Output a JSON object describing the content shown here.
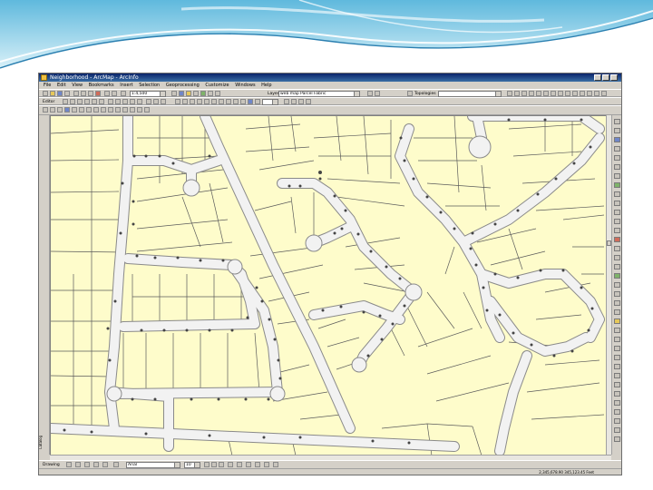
{
  "app": {
    "title": "Neighborhood - ArcMap - ArcInfo",
    "menu": [
      "File",
      "Edit",
      "View",
      "Bookmarks",
      "Insert",
      "Selection",
      "Geoprocessing",
      "Customize",
      "Windows",
      "Help"
    ],
    "scale": "1:4,500",
    "layers_label": "Layers:",
    "layer_value": "web map Parcel Fabric",
    "editor_label": "Editor",
    "workspace_label": "Topologies",
    "drawing_label": "Drawing",
    "font_value": "Arial",
    "font_size": "10",
    "coords": "2,345,678.90   345,123.45 Feet",
    "left_tab": "Catalog"
  },
  "colors": {
    "map_background": "#fefccb",
    "road_fill": "#f2f2f2",
    "road_edge": "#8a8a8a",
    "parcel_line": "#5b5b5b",
    "title_bar": "#0a246a"
  }
}
